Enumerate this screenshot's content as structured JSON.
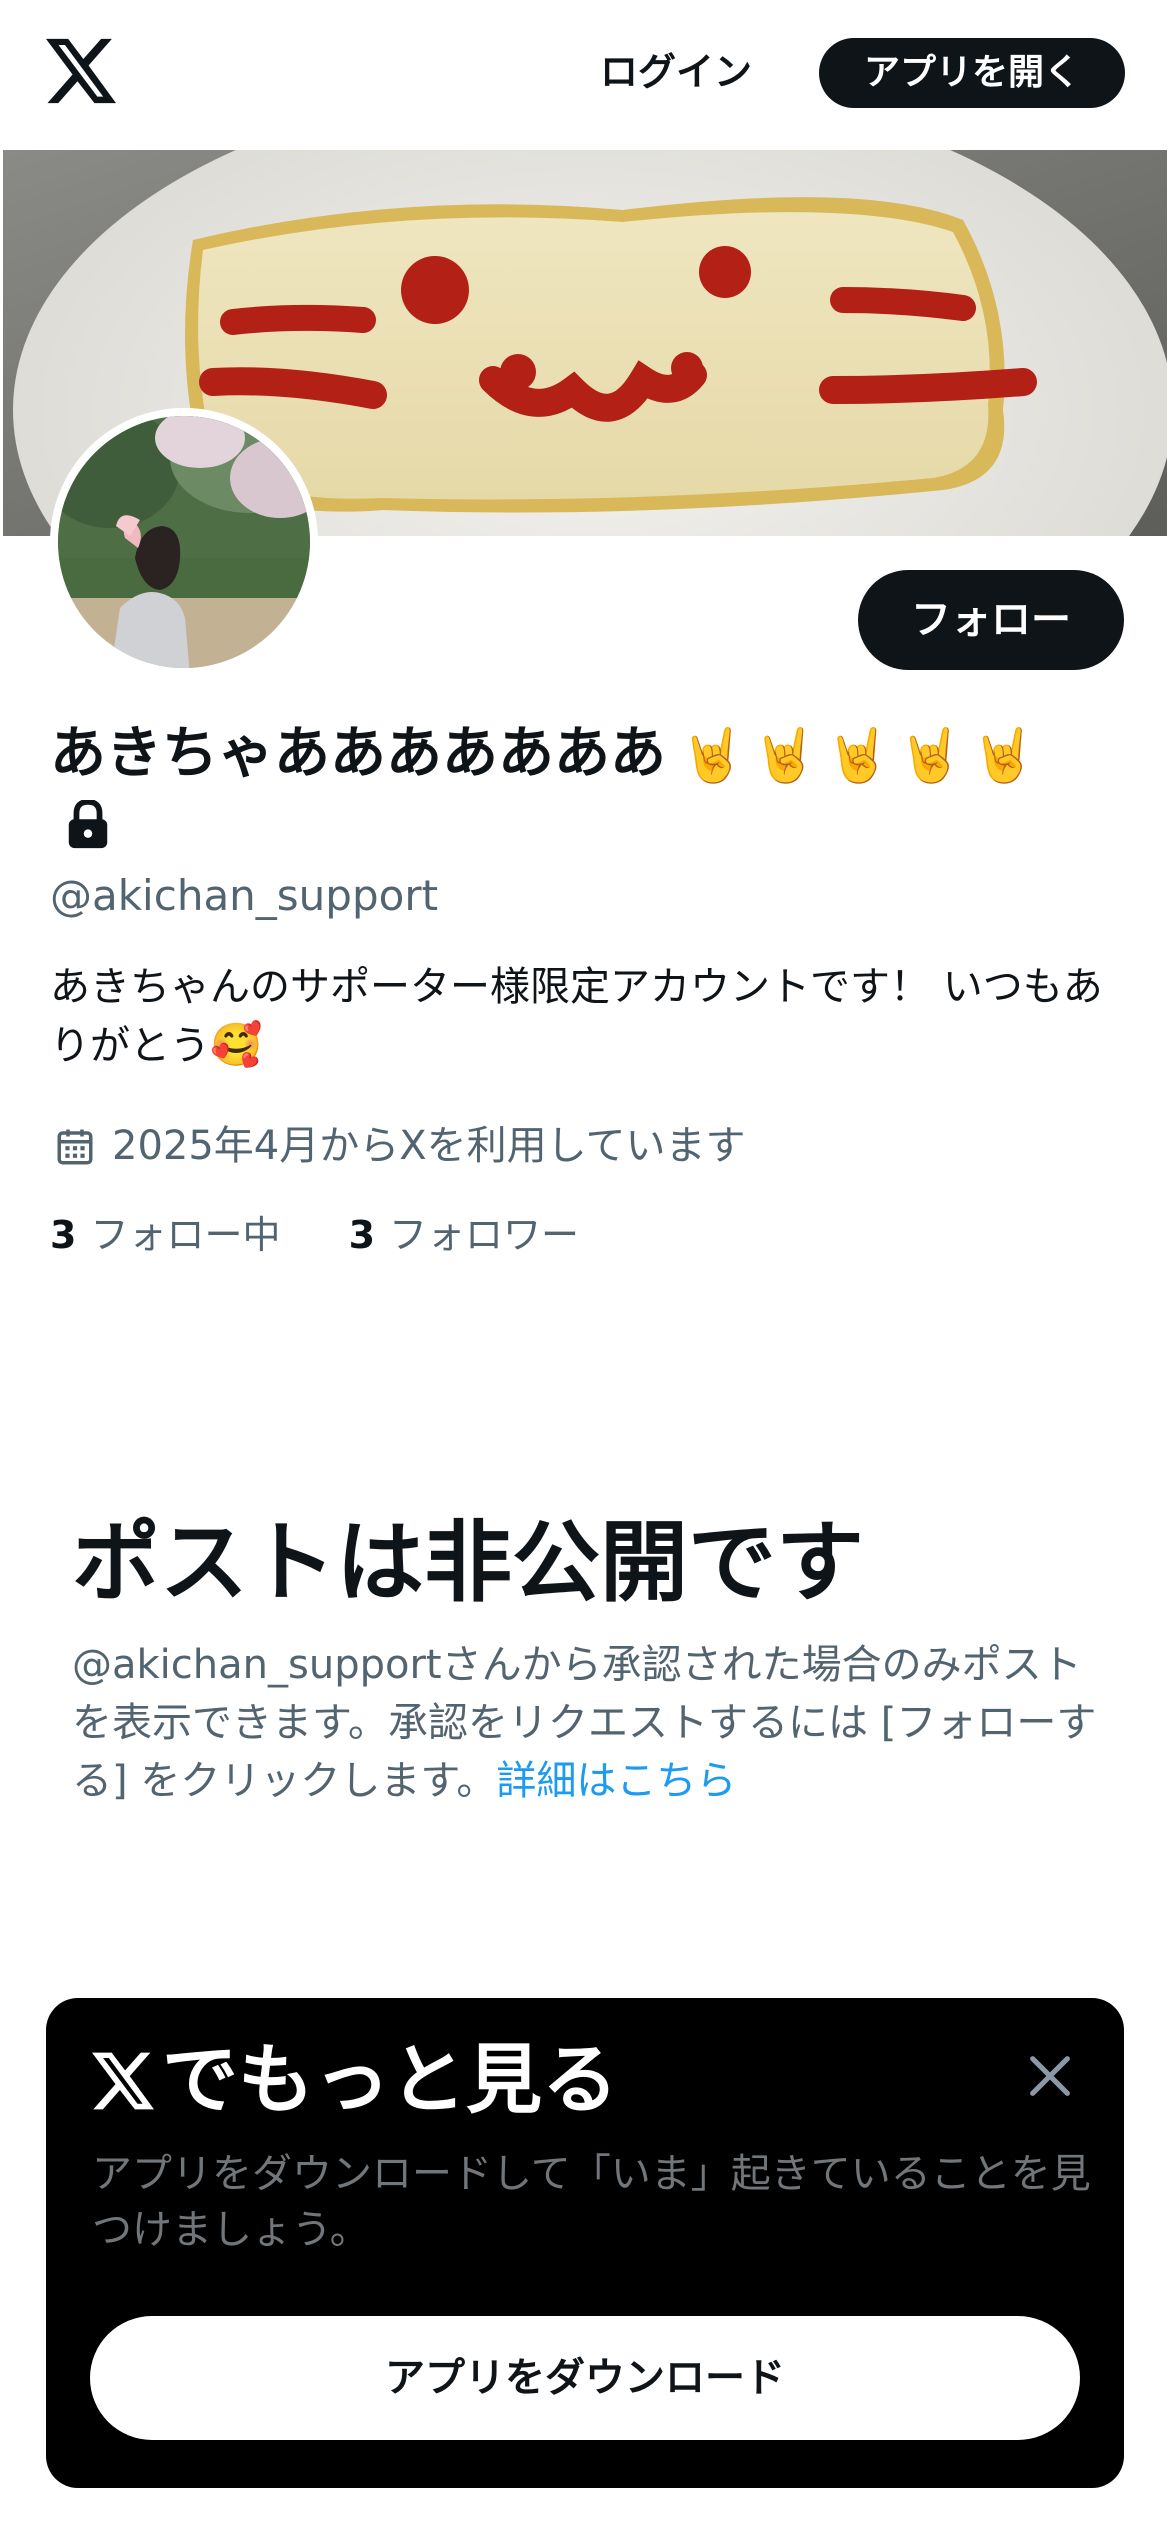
{
  "header": {
    "login_label": "ログイン",
    "open_app_label": "アプリを開く",
    "logo_icon": "x-logo-icon"
  },
  "profile": {
    "follow_label": "フォロー",
    "display_name": "あきちゃあああああああ",
    "name_emojis": "🤘🤘🤘🤘🤘",
    "protected_icon": "lock-icon",
    "handle": "@akichan_support",
    "bio": "あきちゃんのサポーター様限定アカウントです！ いつもありがとう",
    "bio_emoji": "🥰",
    "joined": "2025年4月からXを利用しています",
    "joined_icon": "calendar-icon",
    "following_count": "3",
    "following_label": "フォロー中",
    "followers_count": "3",
    "followers_label": "フォロワー"
  },
  "private_notice": {
    "title": "ポストは非公開です",
    "description": "@akichan_supportさんから承認された場合のみポストを表示できます。承認をリクエストするには [フォローする] をクリックします。",
    "learn_more": "詳細はこちら"
  },
  "promo": {
    "title": "でもっと見る",
    "description": "アプリをダウンロードして「いま」起きていることを見つけましょう。",
    "download_label": "アプリをダウンロード",
    "close_icon": "close-icon"
  },
  "colors": {
    "text_primary": "#0f1419",
    "text_secondary": "#536471",
    "link": "#1d9bf0",
    "promo_bg": "#000000"
  }
}
